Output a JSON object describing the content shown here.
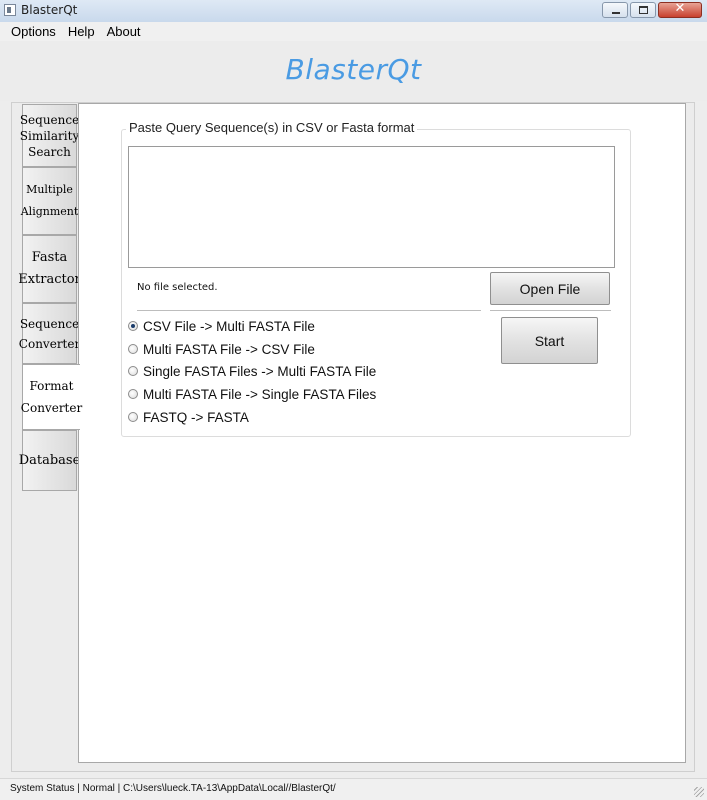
{
  "window": {
    "title": "BlasterQt",
    "close_glyph": "✕"
  },
  "menu": {
    "items": [
      {
        "label": "Options"
      },
      {
        "label": "Help"
      },
      {
        "label": "About"
      }
    ]
  },
  "header": {
    "app_name": "BlasterQt",
    "accent_color": "#4a9be3"
  },
  "sidebar": {
    "tabs": [
      {
        "label": "Sequence Similarity Search",
        "active": false
      },
      {
        "label": "Multiple Alignment",
        "active": false
      },
      {
        "label": "Fasta Extractor",
        "active": false
      },
      {
        "label": "Sequence Converter",
        "active": false
      },
      {
        "label": "Format Converter",
        "active": true
      },
      {
        "label": "Database",
        "active": false
      }
    ]
  },
  "format_converter": {
    "group_title": "Paste Query Sequence(s) in CSV or Fasta format",
    "query_text": "",
    "file_status": "No file selected.",
    "open_file_label": "Open File",
    "start_label": "Start",
    "options": [
      {
        "label": "CSV File -> Multi FASTA File",
        "checked": true
      },
      {
        "label": "Multi FASTA File -> CSV File",
        "checked": false
      },
      {
        "label": "Single FASTA Files -> Multi FASTA File",
        "checked": false
      },
      {
        "label": "Multi FASTA File -> Single FASTA Files",
        "checked": false
      },
      {
        "label": "FASTQ -> FASTA",
        "checked": false
      }
    ]
  },
  "status_bar": {
    "text": "System Status | Normal | C:\\Users\\lueck.TA-13\\AppData\\Local//BlasterQt/"
  }
}
